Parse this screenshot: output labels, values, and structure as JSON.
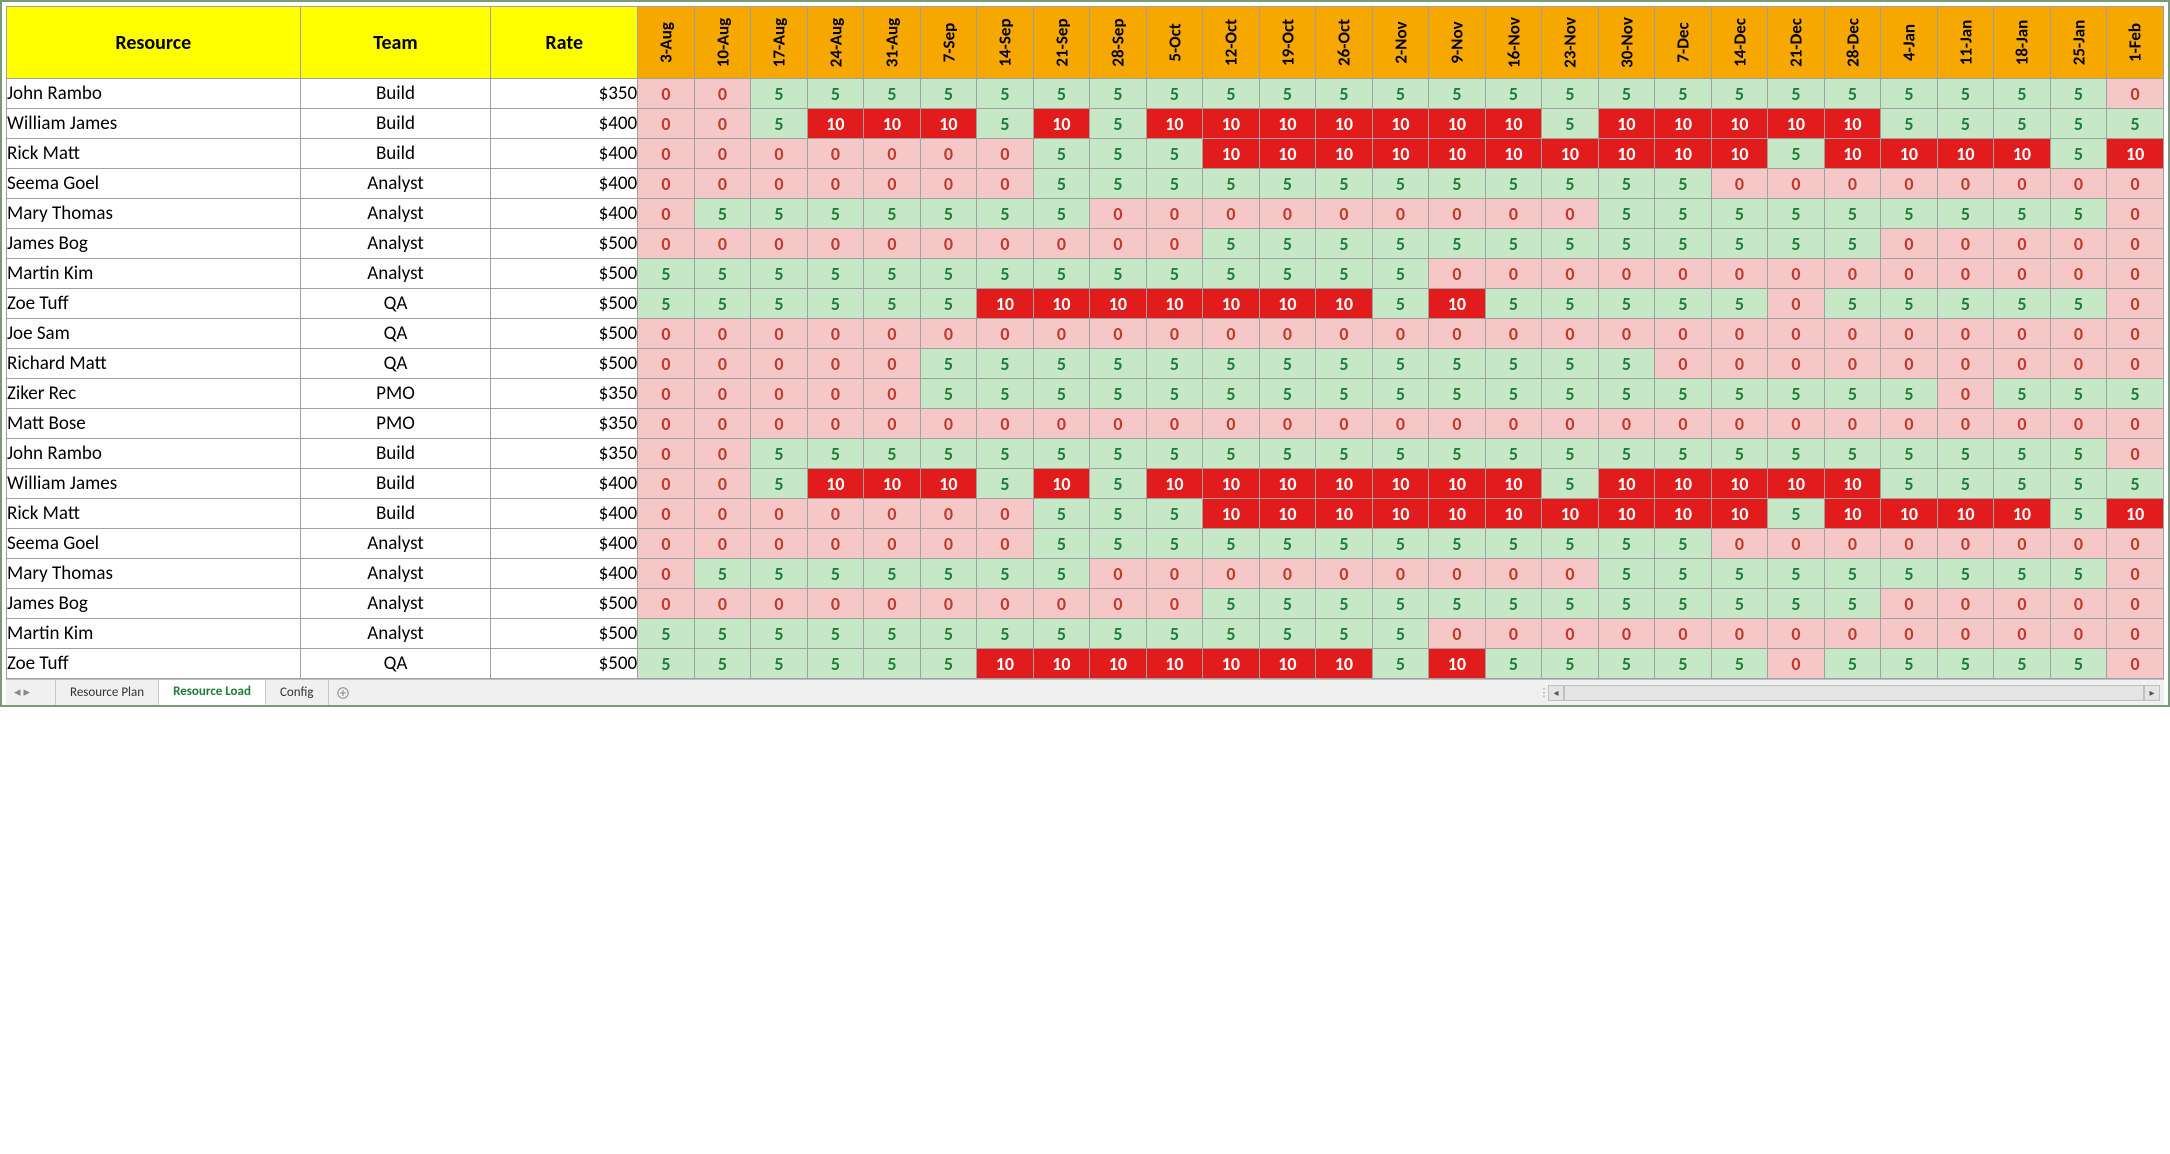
{
  "headers": {
    "resource": "Resource",
    "team": "Team",
    "rate": "Rate"
  },
  "dates": [
    "3-Aug",
    "10-Aug",
    "17-Aug",
    "24-Aug",
    "31-Aug",
    "7-Sep",
    "14-Sep",
    "21-Sep",
    "28-Sep",
    "5-Oct",
    "12-Oct",
    "19-Oct",
    "26-Oct",
    "2-Nov",
    "9-Nov",
    "16-Nov",
    "23-Nov",
    "30-Nov",
    "7-Dec",
    "14-Dec",
    "21-Dec",
    "28-Dec",
    "4-Jan",
    "11-Jan",
    "18-Jan",
    "25-Jan",
    "1-Feb"
  ],
  "rows": [
    {
      "resource": "John Rambo",
      "team": "Build",
      "rate": "$350",
      "load": [
        0,
        0,
        5,
        5,
        5,
        5,
        5,
        5,
        5,
        5,
        5,
        5,
        5,
        5,
        5,
        5,
        5,
        5,
        5,
        5,
        5,
        5,
        5,
        5,
        5,
        5,
        0
      ]
    },
    {
      "resource": "William James",
      "team": "Build",
      "rate": "$400",
      "load": [
        0,
        0,
        5,
        10,
        10,
        10,
        5,
        10,
        5,
        10,
        10,
        10,
        10,
        10,
        10,
        10,
        5,
        10,
        10,
        10,
        10,
        10,
        5,
        5,
        5,
        5,
        5
      ]
    },
    {
      "resource": "Rick Matt",
      "team": "Build",
      "rate": "$400",
      "load": [
        0,
        0,
        0,
        0,
        0,
        0,
        0,
        5,
        5,
        5,
        10,
        10,
        10,
        10,
        10,
        10,
        10,
        10,
        10,
        10,
        5,
        10,
        10,
        10,
        10,
        5,
        10
      ]
    },
    {
      "resource": "Seema Goel",
      "team": "Analyst",
      "rate": "$400",
      "load": [
        0,
        0,
        0,
        0,
        0,
        0,
        0,
        5,
        5,
        5,
        5,
        5,
        5,
        5,
        5,
        5,
        5,
        5,
        5,
        0,
        0,
        0,
        0,
        0,
        0,
        0,
        0
      ]
    },
    {
      "resource": "Mary Thomas",
      "team": "Analyst",
      "rate": "$400",
      "load": [
        0,
        5,
        5,
        5,
        5,
        5,
        5,
        5,
        0,
        0,
        0,
        0,
        0,
        0,
        0,
        0,
        0,
        5,
        5,
        5,
        5,
        5,
        5,
        5,
        5,
        5,
        0
      ]
    },
    {
      "resource": "James Bog",
      "team": "Analyst",
      "rate": "$500",
      "load": [
        0,
        0,
        0,
        0,
        0,
        0,
        0,
        0,
        0,
        0,
        5,
        5,
        5,
        5,
        5,
        5,
        5,
        5,
        5,
        5,
        5,
        5,
        0,
        0,
        0,
        0,
        0
      ]
    },
    {
      "resource": "Martin Kim",
      "team": "Analyst",
      "rate": "$500",
      "load": [
        5,
        5,
        5,
        5,
        5,
        5,
        5,
        5,
        5,
        5,
        5,
        5,
        5,
        5,
        0,
        0,
        0,
        0,
        0,
        0,
        0,
        0,
        0,
        0,
        0,
        0,
        0
      ]
    },
    {
      "resource": "Zoe Tuff",
      "team": "QA",
      "rate": "$500",
      "load": [
        5,
        5,
        5,
        5,
        5,
        5,
        10,
        10,
        10,
        10,
        10,
        10,
        10,
        5,
        10,
        5,
        5,
        5,
        5,
        5,
        0,
        5,
        5,
        5,
        5,
        5,
        0
      ]
    },
    {
      "resource": "Joe Sam",
      "team": "QA",
      "rate": "$500",
      "load": [
        0,
        0,
        0,
        0,
        0,
        0,
        0,
        0,
        0,
        0,
        0,
        0,
        0,
        0,
        0,
        0,
        0,
        0,
        0,
        0,
        0,
        0,
        0,
        0,
        0,
        0,
        0
      ]
    },
    {
      "resource": "Richard Matt",
      "team": "QA",
      "rate": "$500",
      "load": [
        0,
        0,
        0,
        0,
        0,
        5,
        5,
        5,
        5,
        5,
        5,
        5,
        5,
        5,
        5,
        5,
        5,
        5,
        0,
        0,
        0,
        0,
        0,
        0,
        0,
        0,
        0
      ]
    },
    {
      "resource": "Ziker Rec",
      "team": "PMO",
      "rate": "$350",
      "load": [
        0,
        0,
        0,
        0,
        0,
        5,
        5,
        5,
        5,
        5,
        5,
        5,
        5,
        5,
        5,
        5,
        5,
        5,
        5,
        5,
        5,
        5,
        5,
        0,
        5,
        5,
        5
      ]
    },
    {
      "resource": "Matt Bose",
      "team": "PMO",
      "rate": "$350",
      "load": [
        0,
        0,
        0,
        0,
        0,
        0,
        0,
        0,
        0,
        0,
        0,
        0,
        0,
        0,
        0,
        0,
        0,
        0,
        0,
        0,
        0,
        0,
        0,
        0,
        0,
        0,
        0
      ]
    },
    {
      "resource": "John Rambo",
      "team": "Build",
      "rate": "$350",
      "load": [
        0,
        0,
        5,
        5,
        5,
        5,
        5,
        5,
        5,
        5,
        5,
        5,
        5,
        5,
        5,
        5,
        5,
        5,
        5,
        5,
        5,
        5,
        5,
        5,
        5,
        5,
        0
      ]
    },
    {
      "resource": "William James",
      "team": "Build",
      "rate": "$400",
      "load": [
        0,
        0,
        5,
        10,
        10,
        10,
        5,
        10,
        5,
        10,
        10,
        10,
        10,
        10,
        10,
        10,
        5,
        10,
        10,
        10,
        10,
        10,
        5,
        5,
        5,
        5,
        5
      ]
    },
    {
      "resource": "Rick Matt",
      "team": "Build",
      "rate": "$400",
      "load": [
        0,
        0,
        0,
        0,
        0,
        0,
        0,
        5,
        5,
        5,
        10,
        10,
        10,
        10,
        10,
        10,
        10,
        10,
        10,
        10,
        5,
        10,
        10,
        10,
        10,
        5,
        10
      ]
    },
    {
      "resource": "Seema Goel",
      "team": "Analyst",
      "rate": "$400",
      "load": [
        0,
        0,
        0,
        0,
        0,
        0,
        0,
        5,
        5,
        5,
        5,
        5,
        5,
        5,
        5,
        5,
        5,
        5,
        5,
        0,
        0,
        0,
        0,
        0,
        0,
        0,
        0
      ]
    },
    {
      "resource": "Mary Thomas",
      "team": "Analyst",
      "rate": "$400",
      "load": [
        0,
        5,
        5,
        5,
        5,
        5,
        5,
        5,
        0,
        0,
        0,
        0,
        0,
        0,
        0,
        0,
        0,
        5,
        5,
        5,
        5,
        5,
        5,
        5,
        5,
        5,
        0
      ]
    },
    {
      "resource": "James Bog",
      "team": "Analyst",
      "rate": "$500",
      "load": [
        0,
        0,
        0,
        0,
        0,
        0,
        0,
        0,
        0,
        0,
        5,
        5,
        5,
        5,
        5,
        5,
        5,
        5,
        5,
        5,
        5,
        5,
        0,
        0,
        0,
        0,
        0
      ]
    },
    {
      "resource": "Martin Kim",
      "team": "Analyst",
      "rate": "$500",
      "load": [
        5,
        5,
        5,
        5,
        5,
        5,
        5,
        5,
        5,
        5,
        5,
        5,
        5,
        5,
        0,
        0,
        0,
        0,
        0,
        0,
        0,
        0,
        0,
        0,
        0,
        0,
        0
      ]
    },
    {
      "resource": "Zoe Tuff",
      "team": "QA",
      "rate": "$500",
      "load": [
        5,
        5,
        5,
        5,
        5,
        5,
        10,
        10,
        10,
        10,
        10,
        10,
        10,
        5,
        10,
        5,
        5,
        5,
        5,
        5,
        0,
        5,
        5,
        5,
        5,
        5,
        0
      ]
    }
  ],
  "tabs": {
    "items": [
      "Resource Plan",
      "Resource Load",
      "Config"
    ],
    "active_index": 1
  }
}
